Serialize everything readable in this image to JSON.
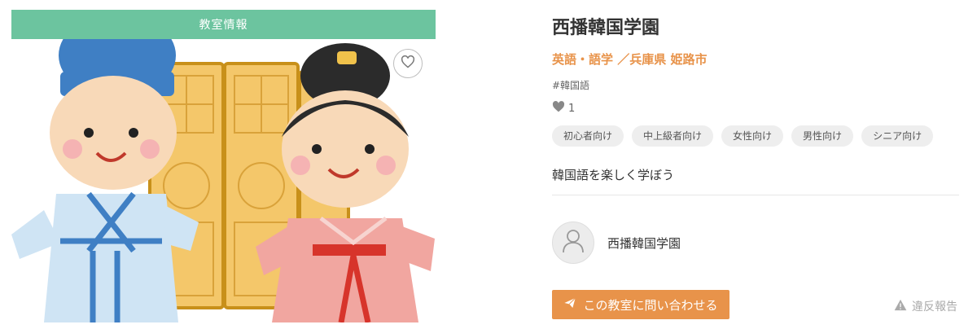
{
  "listing": {
    "category_banner": "教室情報",
    "title": "西播韓国学園",
    "category_line": "英語・語学 ／兵庫県 姫路市",
    "hashtag": "#韓国語",
    "likes": "1",
    "tags": [
      "初心者向け",
      "中上級者向け",
      "女性向け",
      "男性向け",
      "シニア向け"
    ],
    "description": "韓国語を楽しく学ぼう",
    "owner_name": "西播韓国学園",
    "contact_label": "この教室に問い合わせる",
    "report_label": "違反報告"
  },
  "colors": {
    "banner": "#6cc49f",
    "accent": "#e8934a",
    "tag_bg": "#eeeeee"
  },
  "icons": {
    "favorite": "heart-outline-icon",
    "like": "heart-icon",
    "avatar": "user-icon",
    "contact": "send-icon",
    "report": "warning-icon"
  }
}
